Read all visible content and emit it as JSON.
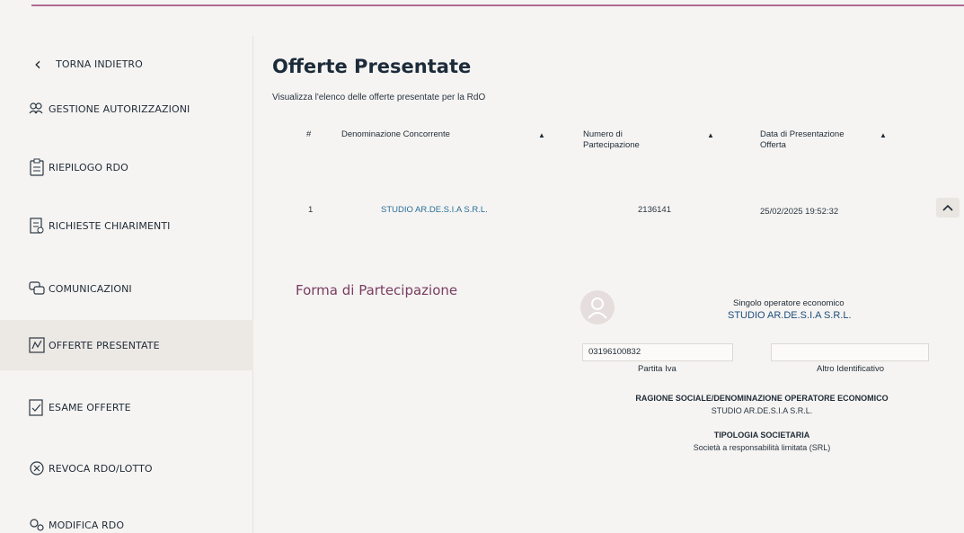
{
  "sidebar": {
    "back": "TORNA INDIETRO",
    "items": [
      {
        "label": "GESTIONE AUTORIZZAZIONI"
      },
      {
        "label": "RIEPILOGO RDO"
      },
      {
        "label": "RICHIESTE CHIARIMENTI"
      },
      {
        "label": "COMUNICAZIONI"
      },
      {
        "label": "OFFERTE PRESENTATE"
      },
      {
        "label": "ESAME OFFERTE"
      },
      {
        "label": "REVOCA RDO/LOTTO"
      },
      {
        "label": "MODIFICA RDO"
      }
    ]
  },
  "main": {
    "title": "Offerte Presentate",
    "subtitle": "Visualizza l'elenco delle offerte presentate per la RdO",
    "table": {
      "columns": [
        "#",
        "Denominazione Concorrente",
        "Numero di Partecipazione",
        "Data di Presentazione Offerta"
      ],
      "rows": [
        {
          "index": "1",
          "name": "STUDIO AR.DE.S.I.A S.R.L.",
          "number": "2136141",
          "date": "25/02/2025 19:52:32"
        }
      ]
    },
    "detail": {
      "section_title": "Forma di Partecipazione",
      "operator_type": "Singolo operatore economico",
      "operator_name": "STUDIO AR.DE.S.I.A S.R.L.",
      "vat_value": "03196100832",
      "vat_label": "Partita Iva",
      "other_id_value": "",
      "other_id_label": "Altro Identificativo",
      "company_heading": "RAGIONE SOCIALE/DENOMINAZIONE OPERATORE ECONOMICO",
      "company_value": "STUDIO AR.DE.S.I.A S.R.L.",
      "type_heading": "TIPOLOGIA SOCIETARIA",
      "type_value": "Società a responsabilità limitata (SRL)"
    }
  },
  "colors": {
    "accent": "#b06a95",
    "link": "#2a6f9a",
    "section_title": "#7a3c62"
  }
}
